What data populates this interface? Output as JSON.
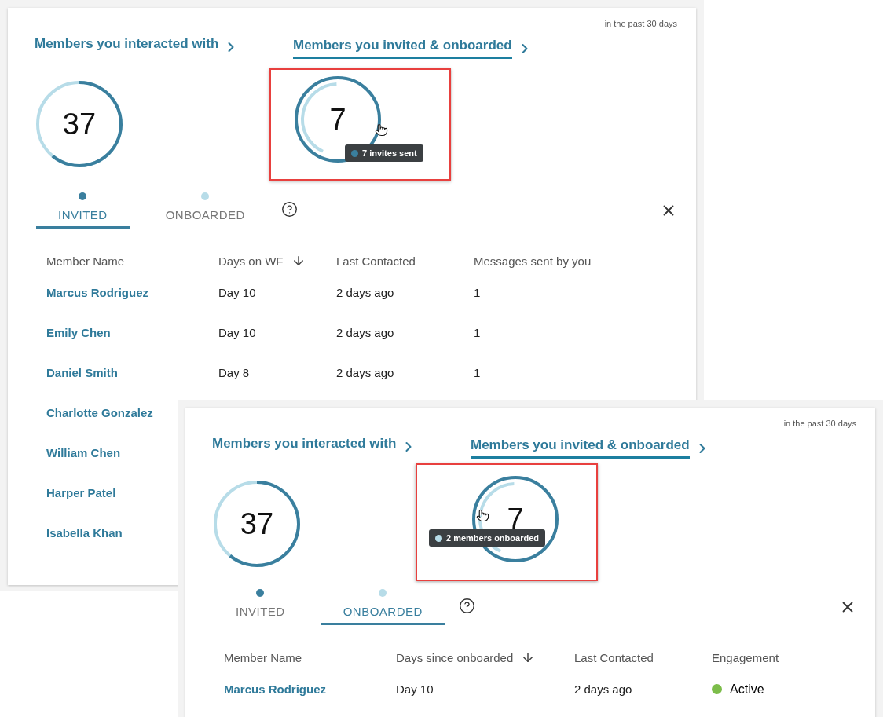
{
  "screenshots": [
    {
      "period": "in the past 30 days",
      "sections": [
        {
          "title": "Members you interacted with",
          "selected": false,
          "count": "37"
        },
        {
          "title": "Members you invited & onboarded",
          "selected": true,
          "count": "7",
          "tooltip": {
            "text": "7 invites sent",
            "color": "#3a7f9e"
          }
        }
      ],
      "tabs": [
        {
          "label": "INVITED",
          "selected": true,
          "color": "#3a7f9e"
        },
        {
          "label": "ONBOARDED",
          "selected": false,
          "color": "#b7dce8"
        }
      ],
      "columns": [
        {
          "label": "Member Name",
          "sorted": false
        },
        {
          "label": "Days on WF",
          "sorted": true
        },
        {
          "label": "Last Contacted",
          "sorted": false
        },
        {
          "label": "Messages sent by you",
          "sorted": false
        }
      ],
      "rows": [
        {
          "cells": [
            "Marcus Rodriguez",
            "Day 10",
            "2 days ago",
            "1"
          ]
        },
        {
          "cells": [
            "Emily Chen",
            "Day 10",
            "2 days ago",
            "1"
          ]
        },
        {
          "cells": [
            "Daniel Smith",
            "Day 8",
            "2 days ago",
            "1"
          ]
        },
        {
          "cells": [
            "Charlotte Gonzalez"
          ]
        },
        {
          "cells": [
            "William Chen"
          ]
        },
        {
          "cells": [
            "Harper Patel"
          ]
        },
        {
          "cells": [
            "Isabella Khan"
          ]
        }
      ]
    },
    {
      "period": "in the past 30 days",
      "sections": [
        {
          "title": "Members you interacted with",
          "selected": false,
          "count": "37"
        },
        {
          "title": "Members you invited & onboarded",
          "selected": true,
          "count": "7",
          "tooltip": {
            "text": "2 members onboarded",
            "color": "#b7dce8"
          }
        }
      ],
      "tabs": [
        {
          "label": "INVITED",
          "selected": false,
          "color": "#3a7f9e"
        },
        {
          "label": "ONBOARDED",
          "selected": true,
          "color": "#b7dce8"
        }
      ],
      "columns": [
        {
          "label": "Member Name",
          "sorted": false
        },
        {
          "label": "Days since onboarded",
          "sorted": true
        },
        {
          "label": "Last Contacted",
          "sorted": false
        },
        {
          "label": "Engagement",
          "sorted": false
        }
      ],
      "rows": [
        {
          "cells": [
            "Marcus Rodriguez",
            "Day 10",
            "2 days ago"
          ],
          "status": {
            "text": "Active",
            "color": "#7cbd4a"
          }
        }
      ]
    }
  ]
}
